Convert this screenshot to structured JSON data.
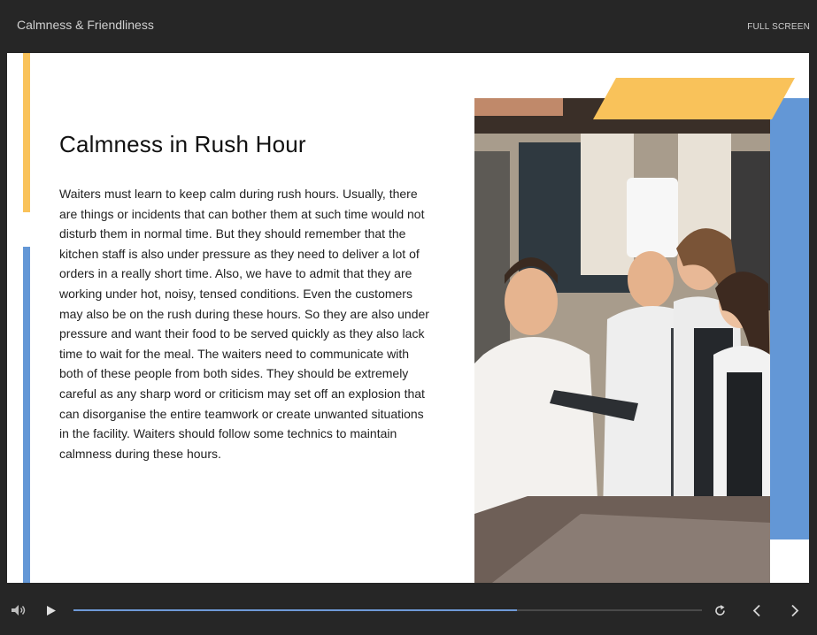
{
  "header": {
    "title": "Calmness & Friendliness",
    "fullscreen_label": "FULL SCREEN"
  },
  "slide": {
    "title": "Calmness in Rush Hour",
    "body": "Waiters must learn to keep calm during rush hours. Usually, there are things or incidents that can bother them at such time would not disturb them in normal time. But they should remember that the kitchen staff is also under pressure as they need to deliver a lot of orders in a really short time. Also, we have to admit that they are working under hot, noisy, tensed conditions. Even the customers may also be on the rush during these hours. So they are also under pressure and want their food to be served quickly as they also lack time to wait for the meal. The waiters need to communicate with both of these people from both sides. They should be extremely careful as any sharp word or criticism may set off an explosion that can disorganise the entire teamwork or create unwanted situations in the facility. Waiters should follow some technics to maintain calmness during these hours."
  },
  "player": {
    "progress": 0.705,
    "icons": [
      "volume-icon",
      "play-icon",
      "replay-icon",
      "previous-icon",
      "next-icon"
    ]
  },
  "colors": {
    "accent_yellow": "#f9c25a",
    "accent_blue": "#6397d6",
    "progress_fill": "#6f9ad8",
    "chrome_background": "#262626"
  }
}
